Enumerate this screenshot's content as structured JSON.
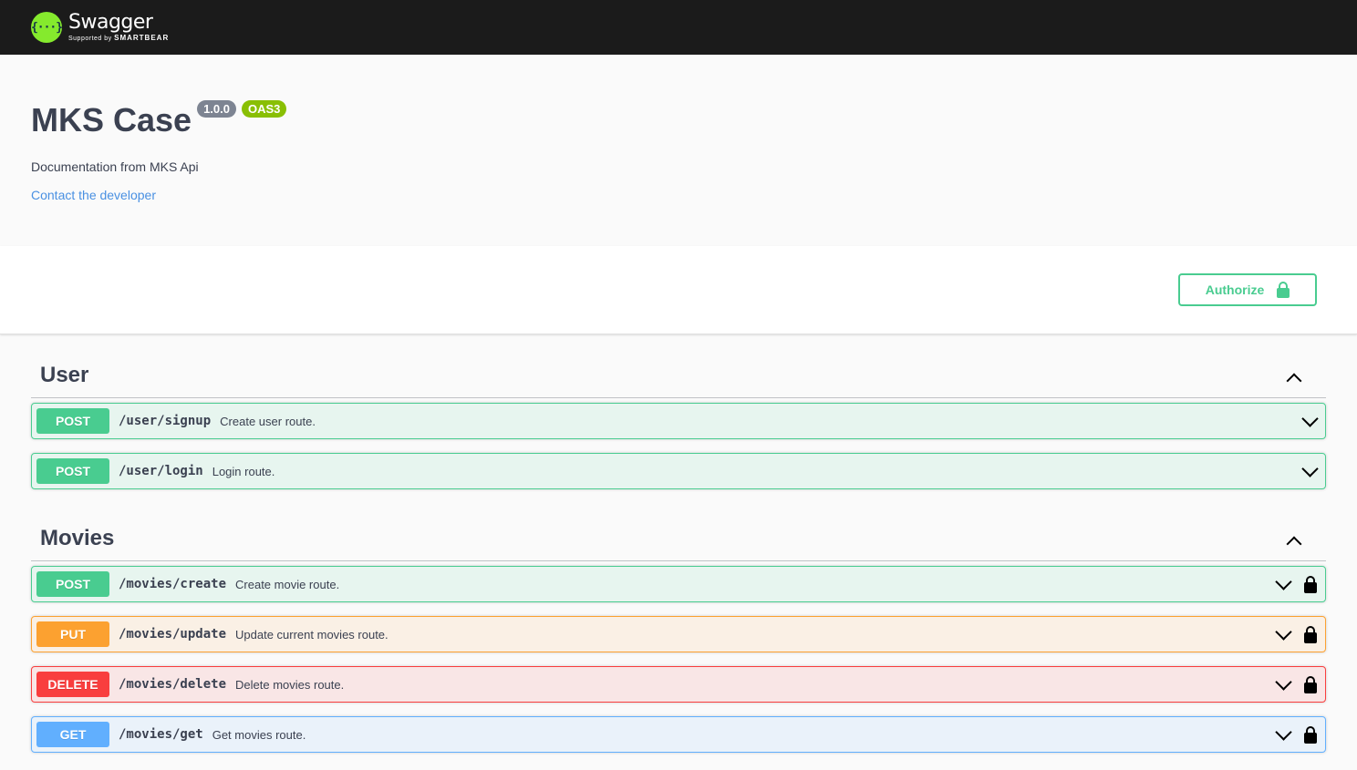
{
  "topbar": {
    "logo_glyph": "{···}",
    "logo_name": "Swagger",
    "logo_sub_prefix": "Supported by",
    "logo_sub_brand": "SMARTBEAR"
  },
  "info": {
    "title": "MKS Case",
    "version": "1.0.0",
    "oas": "OAS3",
    "description": "Documentation from MKS Api",
    "contact": "Contact the developer"
  },
  "authorize": {
    "label": "Authorize"
  },
  "tags": [
    {
      "name": "User",
      "operations": [
        {
          "method": "POST",
          "path": "/user/signup",
          "summary": "Create user route."
        },
        {
          "method": "POST",
          "path": "/user/login",
          "summary": "Login route."
        }
      ]
    },
    {
      "name": "Movies",
      "operations": [
        {
          "method": "POST",
          "path": "/movies/create",
          "summary": "Create movie route."
        },
        {
          "method": "PUT",
          "path": "/movies/update",
          "summary": "Update current movies route."
        },
        {
          "method": "DELETE",
          "path": "/movies/delete",
          "summary": "Delete movies route."
        },
        {
          "method": "GET",
          "path": "/movies/get",
          "summary": "Get movies route."
        }
      ]
    }
  ],
  "colors": {
    "post": "#49cc90",
    "put": "#fca130",
    "delete": "#f93e3e",
    "get": "#61affe",
    "logo": "#85ea2d",
    "link": "#4990e2"
  }
}
